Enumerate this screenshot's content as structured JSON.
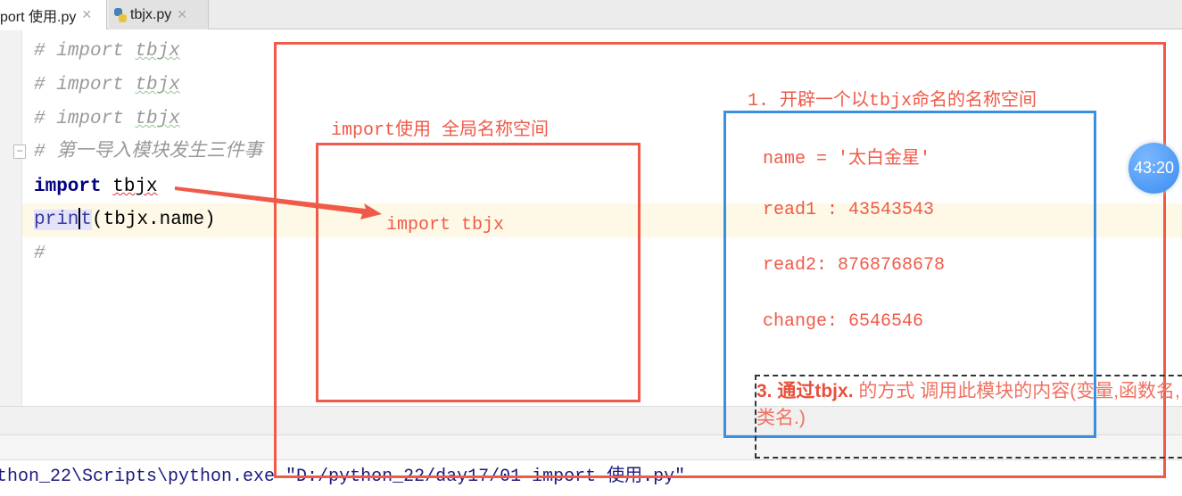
{
  "tabs": [
    {
      "label": "port 使用.py",
      "active": true
    },
    {
      "label": "tbjx.py",
      "active": false,
      "icon": "python-file-icon"
    }
  ],
  "tab_close": "✕",
  "code": {
    "lines": [
      "# import tbjx",
      "# import tbjx",
      "# import tbjx",
      "# 第一导入模块发生三件事",
      "import tbjx",
      "print(tbjx.name)",
      "#"
    ],
    "l4_kw": "import",
    "l4_mod": "tbjx",
    "l5_fn_a": "prin",
    "l5_fn_b": "t",
    "l5_rest": "(tbjx.name)",
    "c_hash": "# ",
    "c_kw": "import ",
    "c_mod": "tbjx"
  },
  "console": {
    "command": "thon_22\\Scripts\\python.exe \"D:/python_22/day17/01 import 使用.py\""
  },
  "annotations": {
    "global_label": "import使用 全局名称空间",
    "arrow_target": "import tbjx",
    "step1": "1. 开辟一个以tbjx命名的名称空间",
    "module_items": [
      "name = '太白金星'",
      "read1 : 43543543",
      "read2: 8768768678",
      "change: 6546546"
    ],
    "step3_a": "3. 通过",
    "step3_b": "tbjx.",
    "step3_c": " 的方式 调用此模块的内容(变量,函数名,类名.)"
  },
  "timer": "43:20",
  "colors": {
    "annotation_red": "#f05a48",
    "module_blue": "#3a8fe0",
    "keyword": "#000080"
  }
}
